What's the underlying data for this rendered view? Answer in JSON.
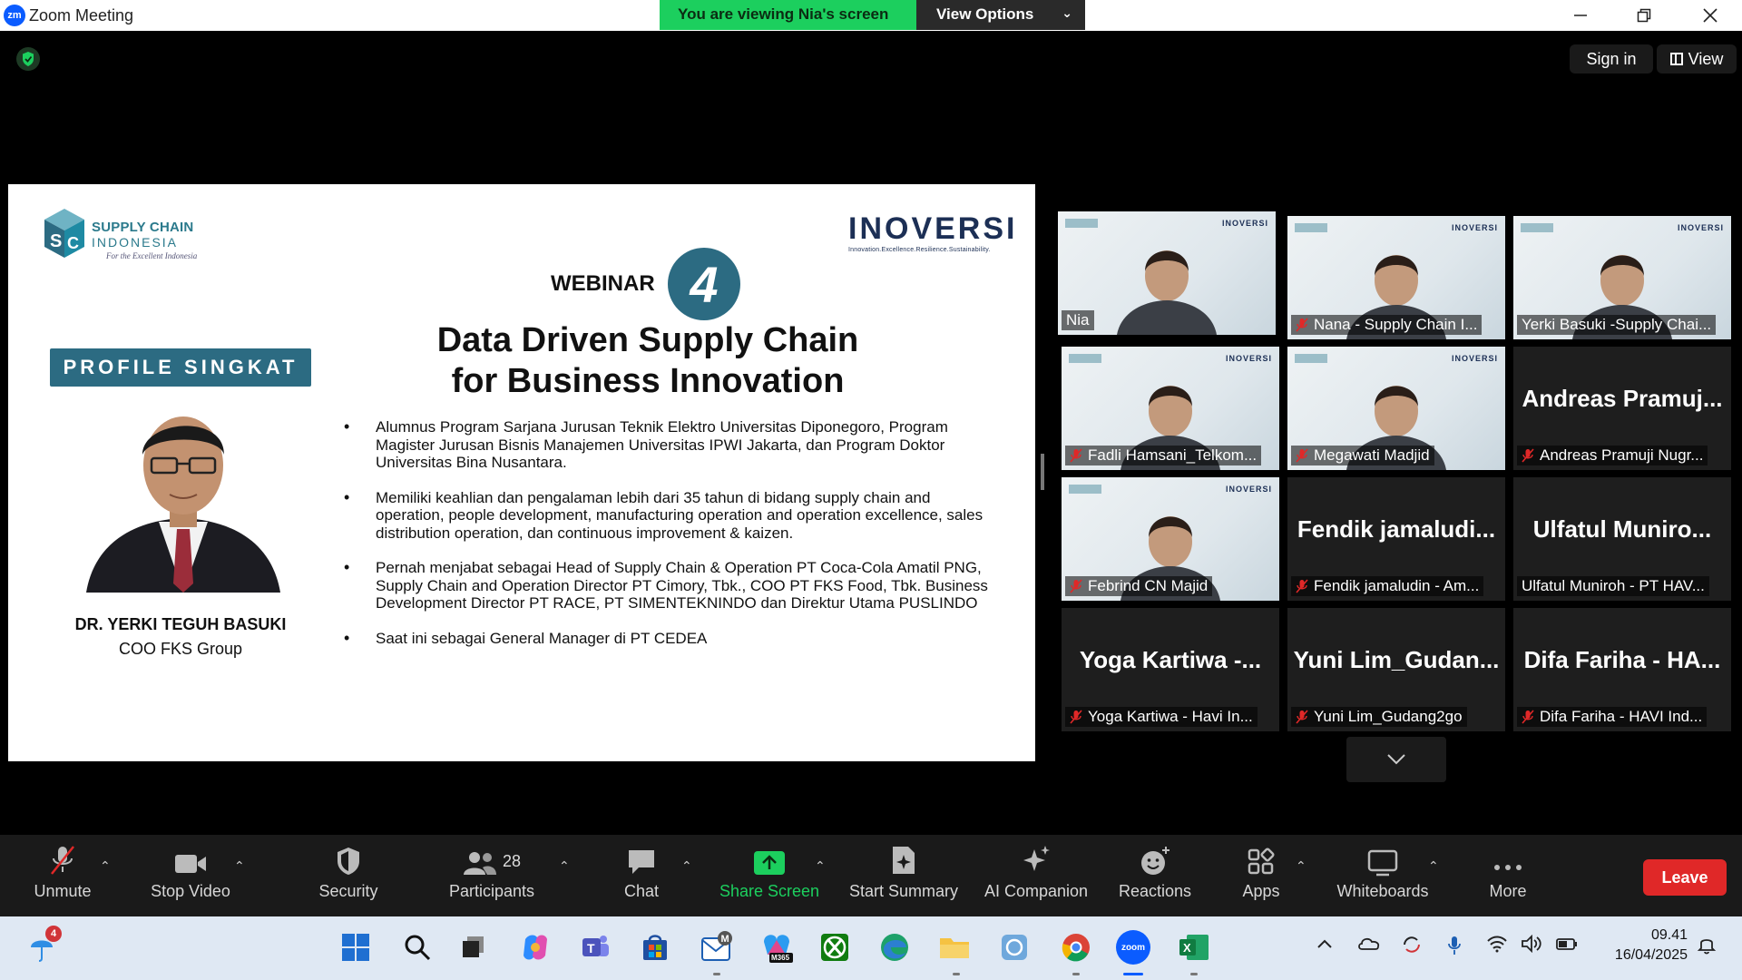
{
  "window": {
    "app_title": "Zoom Meeting",
    "banner_text": "You are viewing Nia's screen",
    "view_options_label": "View Options"
  },
  "top_right": {
    "sign_in": "Sign in",
    "view": "View"
  },
  "slide": {
    "logo_line1": "SUPPLY CHAIN",
    "logo_line2": "INDONESIA",
    "logo_tagline": "For the Excellent Indonesia",
    "partner_brand": "INOVERSI",
    "partner_tagline": "Innovation.Excellence.Resilience.Sustainability.",
    "webinar_label": "WEBINAR",
    "webinar_number": "4",
    "headline_line1": "Data Driven Supply Chain",
    "headline_line2": "for Business Innovation",
    "profile_badge": "PROFILE SINGKAT",
    "speaker_name": "DR. YERKI TEGUH BASUKI",
    "speaker_role": "COO FKS Group",
    "bullets": [
      "Alumnus Program Sarjana Jurusan Teknik Elektro Universitas Diponegoro, Program Magister Jurusan Bisnis Manajemen Universitas IPWI Jakarta, dan Program Doktor Universitas Bina Nusantara.",
      "Memiliki keahlian dan pengalaman lebih dari 35 tahun di bidang supply chain and operation, people development, manufacturing operation and operation excellence, sales distribution operation, dan continuous improvement & kaizen.",
      "Pernah menjabat sebagai Head of Supply Chain & Operation PT Coca-Cola Amatil PNG, Supply Chain and Operation Director PT Cimory, Tbk., COO PT FKS Food, Tbk. Business Development Director PT RACE, PT SIMENTEKNINDO dan Direktur Utama PUSLINDO",
      "Saat ini sebagai General Manager di PT CEDEA"
    ]
  },
  "participants": [
    {
      "label": "Nia",
      "big": "",
      "video": true,
      "muted": false,
      "active": true
    },
    {
      "label": "Nana - Supply Chain I...",
      "big": "",
      "video": true,
      "muted": true,
      "active": false
    },
    {
      "label": "Yerki Basuki -Supply Chai...",
      "big": "",
      "video": true,
      "muted": false,
      "active": false
    },
    {
      "label": "Fadli Hamsani_Telkom...",
      "big": "",
      "video": true,
      "muted": true,
      "active": false
    },
    {
      "label": "Megawati Madjid",
      "big": "",
      "video": true,
      "muted": true,
      "active": false
    },
    {
      "label": "Andreas Pramuji Nugr...",
      "big": "Andreas Pramuj...",
      "video": false,
      "muted": true,
      "active": false
    },
    {
      "label": "Febrind CN Majid",
      "big": "",
      "video": true,
      "muted": true,
      "active": false
    },
    {
      "label": "Fendik jamaludin - Am...",
      "big": "Fendik jamaludi...",
      "video": false,
      "muted": true,
      "active": false
    },
    {
      "label": "Ulfatul Muniroh - PT HAV...",
      "big": "Ulfatul Muniro...",
      "video": false,
      "muted": false,
      "active": false
    },
    {
      "label": "Yoga Kartiwa - Havi In...",
      "big": "Yoga Kartiwa -...",
      "video": false,
      "muted": true,
      "active": false
    },
    {
      "label": "Yuni Lim_Gudang2go",
      "big": "Yuni Lim_Gudan...",
      "video": false,
      "muted": true,
      "active": false
    },
    {
      "label": "Difa Fariha - HAVI Ind...",
      "big": "Difa Fariha - HA...",
      "video": false,
      "muted": true,
      "active": false
    }
  ],
  "toolbar": {
    "unmute": "Unmute",
    "stop_video": "Stop Video",
    "security": "Security",
    "participants": "Participants",
    "participants_count": "28",
    "chat": "Chat",
    "share_screen": "Share Screen",
    "start_summary": "Start Summary",
    "ai_companion": "AI Companion",
    "reactions": "Reactions",
    "apps": "Apps",
    "whiteboards": "Whiteboards",
    "more": "More",
    "leave": "Leave"
  },
  "taskbar": {
    "weather_badge": "4",
    "m365_label": "M365",
    "zoom_label": "zoom",
    "time": "09.41",
    "date": "16/04/2025"
  },
  "colors": {
    "accent_green": "#1ccf5e",
    "slide_teal": "#2c6b82",
    "leave_red": "#e02828",
    "active_speaker": "#d6f46b"
  }
}
